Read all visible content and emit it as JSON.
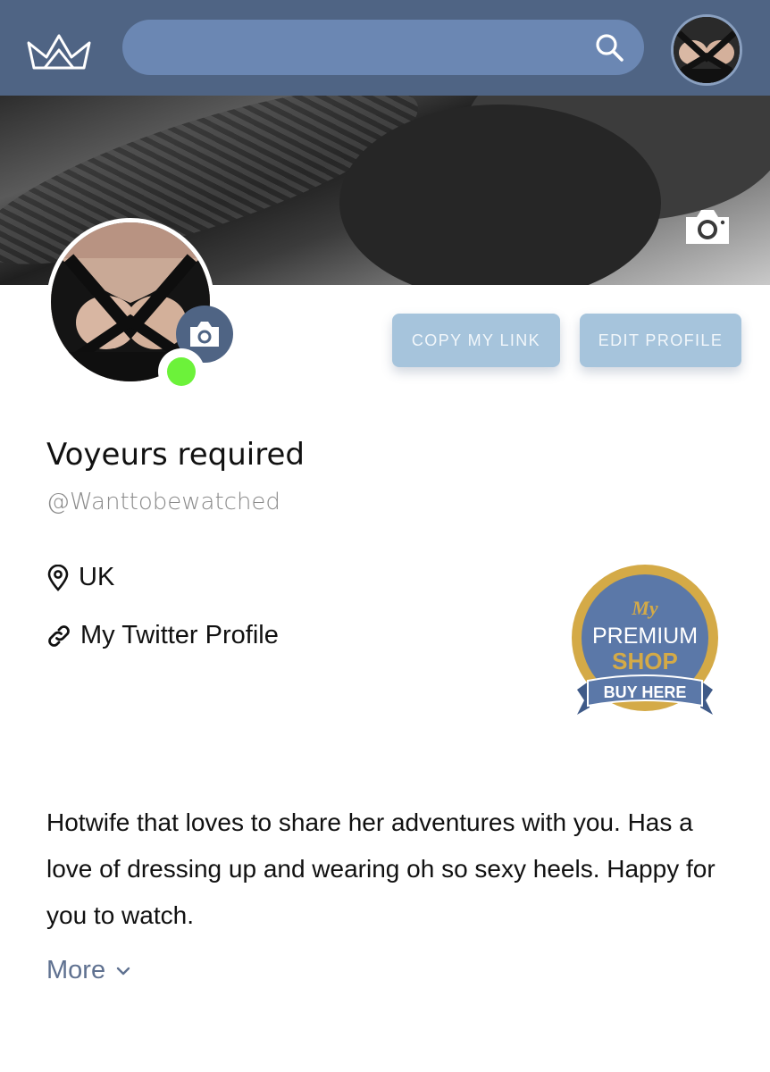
{
  "header": {
    "logo_icon": "crown-icon",
    "search": {
      "placeholder": "",
      "icon": "search-icon"
    },
    "avatar_icon": "user-avatar"
  },
  "profile": {
    "display_name": "Voyeurs required",
    "handle": "@Wanttobewatched",
    "location": "UK",
    "link_label": "My Twitter Profile",
    "online": true,
    "bio": "Hotwife that loves to share her adventures with you. Has a love of dressing up and wearing oh so sexy heels. Happy for you to watch.",
    "more_label": "More"
  },
  "actions": {
    "copy_link": "COPY MY LINK",
    "edit_profile": "EDIT PROFILE"
  },
  "badge": {
    "line1": "My",
    "line2": "PREMIUM",
    "line3": "SHOP",
    "ribbon": "BUY HERE"
  },
  "colors": {
    "header_bg": "#4f6484",
    "search_bg": "#6b87b3",
    "button_bg": "#a6c4dc",
    "online_green": "#6cf23a",
    "badge_gold": "#d4aa47",
    "badge_blue": "#5b78a8",
    "more_link": "#5f7190"
  }
}
